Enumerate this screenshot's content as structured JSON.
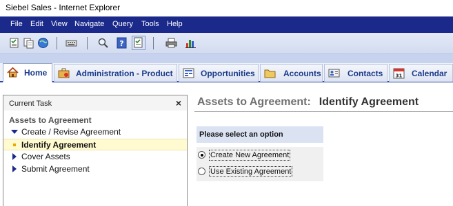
{
  "window": {
    "title": "Siebel Sales - Internet Explorer"
  },
  "menu": [
    "File",
    "Edit",
    "View",
    "Navigate",
    "Query",
    "Tools",
    "Help"
  ],
  "tabs": [
    {
      "label": "Home",
      "icon": "home-icon",
      "active": true
    },
    {
      "label": "Administration - Product",
      "icon": "briefcase-icon",
      "active": false
    },
    {
      "label": "Opportunities",
      "icon": "opportunity-icon",
      "active": false
    },
    {
      "label": "Accounts",
      "icon": "folder-icon",
      "active": false
    },
    {
      "label": "Contacts",
      "icon": "contact-card-icon",
      "active": false
    },
    {
      "label": "Calendar",
      "icon": "calendar-icon",
      "active": false
    }
  ],
  "calendar_day": "31",
  "task_pane": {
    "header": "Current Task",
    "close": "×",
    "task_name": "Assets to Agreement",
    "steps": [
      {
        "label": "Create / Revise Agreement",
        "state": "expanded"
      },
      {
        "label": "Identify Agreement",
        "state": "current"
      },
      {
        "label": "Cover Assets",
        "state": "collapsed"
      },
      {
        "label": "Submit Agreement",
        "state": "collapsed"
      }
    ]
  },
  "main": {
    "title_prefix": "Assets to Agreement:",
    "title": "Identify Agreement",
    "prompt": "Please select an option",
    "options": [
      {
        "label": "Create New Agreement",
        "selected": true
      },
      {
        "label": "Use Existing Agreement",
        "selected": false
      }
    ]
  },
  "colors": {
    "menubar": "#1b2a8a",
    "tab_text": "#1b3a8a",
    "current_step": "#fffad0"
  }
}
